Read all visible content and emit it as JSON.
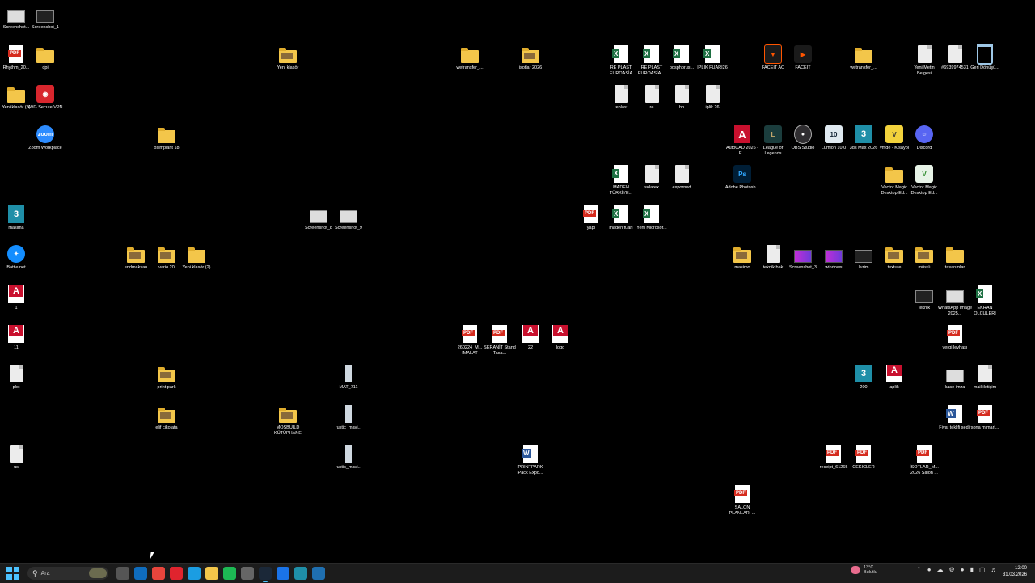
{
  "desktop_icons": [
    {
      "label": "Screenshot...",
      "kind": "shot",
      "icon": "screenshot-icon"
    },
    {
      "label": "Screenshot_1",
      "kind": "shot-dark",
      "icon": "screenshot-icon"
    },
    {
      "label": "Rhythm_20...",
      "kind": "pdf",
      "icon": "pdf-icon"
    },
    {
      "label": "dpi",
      "kind": "folder",
      "icon": "folder-icon"
    },
    {
      "label": "Yeni klasör (3)",
      "kind": "folder",
      "icon": "folder-icon"
    },
    {
      "label": "AVG Secure VPN",
      "kind": "avg",
      "icon": "avg-vpn-icon"
    },
    {
      "label": "Zoom Workplace",
      "kind": "zoom",
      "icon": "zoom-icon"
    },
    {
      "label": "masima",
      "kind": "max",
      "icon": "3dsmax-file-icon"
    },
    {
      "label": "Battle.net",
      "kind": "battlenet",
      "icon": "battlenet-icon"
    },
    {
      "label": "1",
      "kind": "fbx",
      "icon": "fbx-icon"
    },
    {
      "label": "11",
      "kind": "fbx",
      "icon": "fbx-icon"
    },
    {
      "label": "plot",
      "kind": "doc",
      "icon": "document-icon"
    },
    {
      "label": "us",
      "kind": "doc",
      "icon": "document-icon"
    },
    {
      "label": "osimplant 18",
      "kind": "folder",
      "icon": "folder-icon"
    },
    {
      "label": "endmaksan",
      "kind": "folder-img",
      "icon": "folder-icon"
    },
    {
      "label": "vario 20",
      "kind": "folder-img",
      "icon": "folder-icon"
    },
    {
      "label": "Yeni klasör (2)",
      "kind": "folder",
      "icon": "folder-icon"
    },
    {
      "label": "print park",
      "kind": "folder-img",
      "icon": "folder-icon"
    },
    {
      "label": "elif cikolata",
      "kind": "folder-img",
      "icon": "folder-icon"
    },
    {
      "label": "Yeni klasör",
      "kind": "folder-img",
      "icon": "folder-icon"
    },
    {
      "label": "MOSBUILD KÜTÜPHANE",
      "kind": "folder-img",
      "icon": "folder-icon"
    },
    {
      "label": "Screenshot_8",
      "kind": "shot",
      "icon": "screenshot-icon"
    },
    {
      "label": "Screenshot_9",
      "kind": "shot",
      "icon": "screenshot-icon"
    },
    {
      "label": "MAT_711",
      "kind": "img",
      "icon": "image-icon"
    },
    {
      "label": "rustic_mavi...",
      "kind": "img",
      "icon": "image-icon"
    },
    {
      "label": "rustic_mavi...",
      "kind": "img",
      "icon": "image-icon"
    },
    {
      "label": "wetransfer_...",
      "kind": "folder",
      "icon": "folder-icon"
    },
    {
      "label": "isotlar 2026",
      "kind": "folder-img",
      "icon": "folder-icon"
    },
    {
      "label": "260224_M... IMALAT",
      "kind": "pdf",
      "icon": "pdf-icon"
    },
    {
      "label": "SERANİT Stand Tasa...",
      "kind": "pdf",
      "icon": "pdf-icon"
    },
    {
      "label": "22",
      "kind": "fbx",
      "icon": "fbx-icon"
    },
    {
      "label": "logo",
      "kind": "fbx",
      "icon": "fbx-icon"
    },
    {
      "label": "PRINTPARK Pack Expo...",
      "kind": "word",
      "icon": "word-icon"
    },
    {
      "label": "yapı",
      "kind": "pdf",
      "icon": "pdf-icon"
    },
    {
      "label": "RE PLAST EUROASİA",
      "kind": "xls",
      "icon": "excel-icon"
    },
    {
      "label": "RE PLAST EUROASİA ...",
      "kind": "xls",
      "icon": "excel-icon"
    },
    {
      "label": "bosphorus...",
      "kind": "xls",
      "icon": "excel-icon"
    },
    {
      "label": "İPLİK FUARI26",
      "kind": "xls",
      "icon": "excel-icon"
    },
    {
      "label": "replast",
      "kind": "doc",
      "icon": "document-icon"
    },
    {
      "label": "re",
      "kind": "doc",
      "icon": "document-icon"
    },
    {
      "label": "bb",
      "kind": "doc",
      "icon": "document-icon"
    },
    {
      "label": "iplik 26",
      "kind": "doc",
      "icon": "document-icon"
    },
    {
      "label": "MADEN TÜRKİYE...",
      "kind": "xls",
      "icon": "excel-icon"
    },
    {
      "label": "solarex",
      "kind": "doc",
      "icon": "document-icon"
    },
    {
      "label": "exporned",
      "kind": "doc",
      "icon": "document-icon"
    },
    {
      "label": "maden fuarı",
      "kind": "xls",
      "icon": "excel-icon"
    },
    {
      "label": "Yeni Microsof...",
      "kind": "xls",
      "icon": "excel-icon"
    },
    {
      "label": "FACEIT AC",
      "kind": "faceitac",
      "icon": "faceit-ac-icon"
    },
    {
      "label": "FACEIT",
      "kind": "faceit",
      "icon": "faceit-icon"
    },
    {
      "label": "AutoCAD 2026 - E...",
      "kind": "autocad",
      "icon": "autocad-icon"
    },
    {
      "label": "League of Legends",
      "kind": "lol",
      "icon": "league-of-legends-icon"
    },
    {
      "label": "OBS Studio",
      "kind": "obs",
      "icon": "obs-icon"
    },
    {
      "label": "Lumion 10.0",
      "kind": "lumion",
      "icon": "lumion-icon"
    },
    {
      "label": "3ds Max 2026",
      "kind": "max",
      "icon": "3dsmax-icon"
    },
    {
      "label": "vmde - Kisayol",
      "kind": "vmde",
      "icon": "vmde-icon"
    },
    {
      "label": "Discord",
      "kind": "discord",
      "icon": "discord-icon"
    },
    {
      "label": "Adobe Photosh...",
      "kind": "ps",
      "icon": "photoshop-icon"
    },
    {
      "label": "wetransfer_...",
      "kind": "folder",
      "icon": "folder-icon"
    },
    {
      "label": "Yeni Metin Belgesi",
      "kind": "doc",
      "icon": "text-file-icon"
    },
    {
      "label": "#6939974531",
      "kind": "doc",
      "icon": "document-icon"
    },
    {
      "label": "Geri Dönüşü...",
      "kind": "bin",
      "icon": "recycle-bin-icon"
    },
    {
      "label": "Vector Magic Desktop Ed...",
      "kind": "folder",
      "icon": "folder-icon"
    },
    {
      "label": "Vector Magic Desktop Ed...",
      "kind": "vm",
      "icon": "vector-magic-icon"
    },
    {
      "label": "masimo",
      "kind": "folder-img",
      "icon": "folder-icon"
    },
    {
      "label": "teknik.bak",
      "kind": "doc",
      "icon": "document-icon"
    },
    {
      "label": "Screenshot_3",
      "kind": "shot-purple",
      "icon": "screenshot-icon"
    },
    {
      "label": "windows",
      "kind": "shot-purple",
      "icon": "image-icon"
    },
    {
      "label": "lazim",
      "kind": "shot-dark",
      "icon": "image-icon"
    },
    {
      "label": "texture",
      "kind": "folder-img",
      "icon": "folder-icon"
    },
    {
      "label": "müstü",
      "kind": "folder-img",
      "icon": "folder-icon"
    },
    {
      "label": "tasarımlar",
      "kind": "folder",
      "icon": "folder-icon"
    },
    {
      "label": "teknik",
      "kind": "shot-dark",
      "icon": "image-icon"
    },
    {
      "label": "WhatsApp Image 2025...",
      "kind": "shot",
      "icon": "image-icon"
    },
    {
      "label": "EKRAN ÖLÇÜLERİ",
      "kind": "xls",
      "icon": "excel-icon"
    },
    {
      "label": "vergi levhası",
      "kind": "pdf",
      "icon": "pdf-icon"
    },
    {
      "label": "200",
      "kind": "max",
      "icon": "3dsmax-file-icon"
    },
    {
      "label": "aplik",
      "kind": "fbx",
      "icon": "fbx-icon"
    },
    {
      "label": "kase imza",
      "kind": "shot",
      "icon": "image-icon"
    },
    {
      "label": "mail iletişim",
      "kind": "doc",
      "icon": "document-icon"
    },
    {
      "label": "Fiyat teklifi sedir",
      "kind": "word",
      "icon": "word-icon"
    },
    {
      "label": "sona mimarl...",
      "kind": "pdf",
      "icon": "pdf-icon"
    },
    {
      "label": "receipt_61265",
      "kind": "pdf",
      "icon": "pdf-icon"
    },
    {
      "label": "CEKICLER",
      "kind": "pdf",
      "icon": "pdf-icon"
    },
    {
      "label": "İSOTLAR_M... 2026 Salon ...",
      "kind": "pdf",
      "icon": "pdf-icon"
    },
    {
      "label": "SALON PLANLARI ...",
      "kind": "pdf",
      "icon": "pdf-icon"
    }
  ],
  "taskbar": {
    "search_placeholder": "Ara",
    "apps": [
      {
        "icon": "task-view-icon",
        "color": "#555"
      },
      {
        "icon": "outlook-icon",
        "color": "#0f6cbd"
      },
      {
        "icon": "chrome-icon",
        "color": "#e8453c"
      },
      {
        "icon": "opera-icon",
        "color": "#e0242e"
      },
      {
        "icon": "edge-icon",
        "color": "#1b9de2"
      },
      {
        "icon": "file-explorer-icon",
        "color": "#f3c64a"
      },
      {
        "icon": "spotify-icon",
        "color": "#1db954"
      },
      {
        "icon": "chrome-dev-icon",
        "color": "#666"
      },
      {
        "icon": "steam-icon",
        "color": "#1b2838",
        "active": true
      },
      {
        "icon": "onenote-icon",
        "color": "#1a73e8"
      },
      {
        "icon": "3dsmax-icon",
        "color": "#1f8fa8"
      },
      {
        "icon": "snipping-tool-icon",
        "color": "#1f6fb0"
      }
    ],
    "weather_temp": "13°C",
    "weather_desc": "Bulutlu",
    "time": "12:00",
    "date": "31.03.2026"
  }
}
